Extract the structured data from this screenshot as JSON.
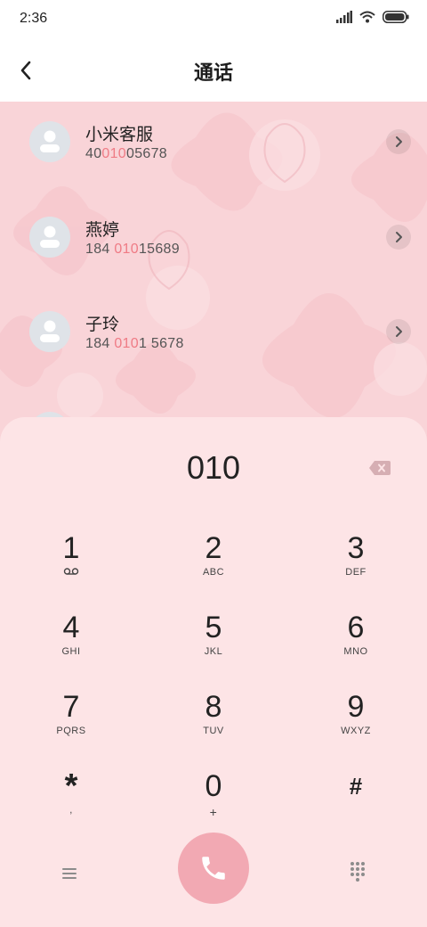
{
  "status_bar": {
    "time": "2:36"
  },
  "header": {
    "title": "通话"
  },
  "contacts": [
    {
      "name": "小米客服",
      "number_pre": "40",
      "number_match": "010",
      "number_post": "05678"
    },
    {
      "name": "燕婷",
      "number_pre": "184 ",
      "number_match": "010",
      "number_post": "15689"
    },
    {
      "name": "子玲",
      "number_pre": "184 ",
      "number_match": "010",
      "number_post": "1 5678"
    }
  ],
  "dialpad": {
    "entered": "010",
    "keys": [
      {
        "digit": "1",
        "sub": ""
      },
      {
        "digit": "2",
        "sub": "ABC"
      },
      {
        "digit": "3",
        "sub": "DEF"
      },
      {
        "digit": "4",
        "sub": "GHI"
      },
      {
        "digit": "5",
        "sub": "JKL"
      },
      {
        "digit": "6",
        "sub": "MNO"
      },
      {
        "digit": "7",
        "sub": "PQRS"
      },
      {
        "digit": "8",
        "sub": "TUV"
      },
      {
        "digit": "9",
        "sub": "WXYZ"
      },
      {
        "digit": "*",
        "sub": ","
      },
      {
        "digit": "0",
        "sub": "+"
      },
      {
        "digit": "#",
        "sub": ""
      }
    ]
  },
  "icons": {
    "back": "back-arrow-icon",
    "voicemail": "voicemail-icon",
    "backspace": "backspace-icon",
    "call": "phone-icon",
    "menu": "menu-icon",
    "keypad": "keypad-icon"
  },
  "colors": {
    "highlight": "#ef7b85",
    "call_button": "#f2a9b3",
    "dialpad_bg": "#fde4e6",
    "wallpaper": "#f9d4d8"
  }
}
